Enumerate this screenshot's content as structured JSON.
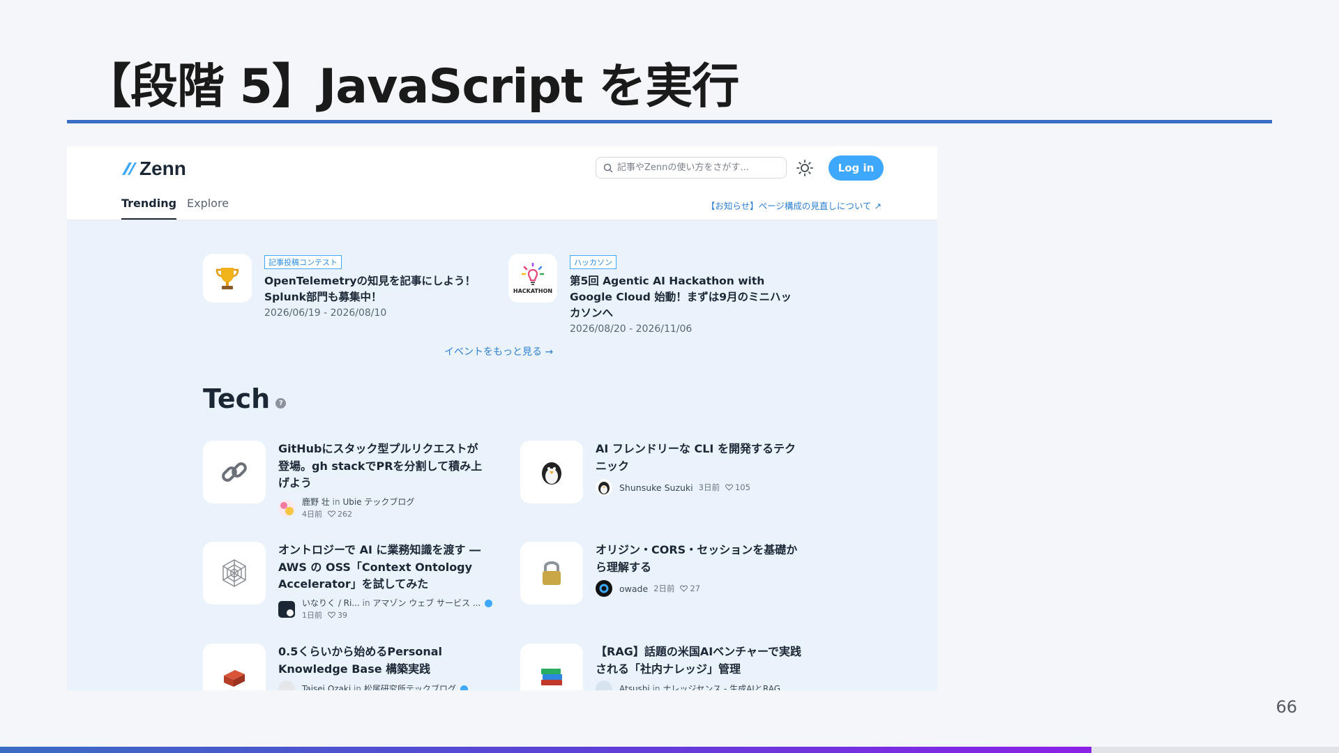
{
  "slide": {
    "title": "【段階 5】JavaScript を実行",
    "page_number": "66"
  },
  "zenn": {
    "logo_text": "Zenn",
    "search_placeholder": "記事やZennの使い方をさがす...",
    "login_label": "Log in",
    "tabs": [
      {
        "label": "Trending",
        "active": true
      },
      {
        "label": "Explore",
        "active": false
      }
    ],
    "notice": "【お知らせ】ページ構成の見直しについて ↗",
    "events": [
      {
        "icon": "trophy-icon",
        "tag": "記事投稿コンテスト",
        "title": "OpenTelemetryの知見を記事にしよう！Splunk部門も募集中！",
        "date": "2026/06/19 - 2026/08/10"
      },
      {
        "icon": "hackathon-lightbulb-icon",
        "icon_caption": "HACKATHON",
        "tag": "ハッカソン",
        "title": "第5回 Agentic AI Hackathon with Google Cloud 始動！まずは9月のミニハッカソンへ",
        "date": "2026/08/20 - 2026/11/06"
      }
    ],
    "more_events": "イベントをもっと見る →",
    "section_title": "Tech",
    "articles": [
      {
        "icon": "link-icon",
        "title": "GitHubにスタック型プルリクエストが登場。gh stackでPRを分割して積み上げよう",
        "author": "鹿野 壮",
        "publication": "Ubie テックブログ",
        "date": "4日前",
        "likes": "262"
      },
      {
        "icon": "penguin-icon",
        "title": "AI フレンドリーな CLI を開発するテクニック",
        "author": "Shunsuke Suzuki",
        "date": "3日前",
        "likes": "105"
      },
      {
        "icon": "spider-web-icon",
        "title": "オントロジーで AI に業務知識を渡す ― AWS の OSS「Context Ontology Accelerator」を試してみた",
        "author": "いなりく / Ri...",
        "publication": "アマゾン ウェブ サービス ...",
        "date": "1日前",
        "likes": "39"
      },
      {
        "icon": "lock-icon",
        "title": "オリジン・CORS・セッションを基礎から理解する",
        "author": "owade",
        "date": "2日前",
        "likes": "27"
      },
      {
        "icon": "bricks-icon",
        "title": "0.5くらいから始めるPersonal Knowledge Base 構築実践",
        "author": "Taisei Ozaki",
        "publication": "松尾研究所テックブログ"
      },
      {
        "icon": "books-icon",
        "title": "【RAG】話題の米国AIベンチャーで実践される「社内ナレッジ」管理",
        "author": "Atsushi",
        "publication": "ナレッジセンス - 生成AIとRAG"
      }
    ]
  },
  "colors": {
    "accent": "#3b6cc4",
    "zenn_blue": "#3ea8ff",
    "page_bg": "#eaf2fc"
  }
}
